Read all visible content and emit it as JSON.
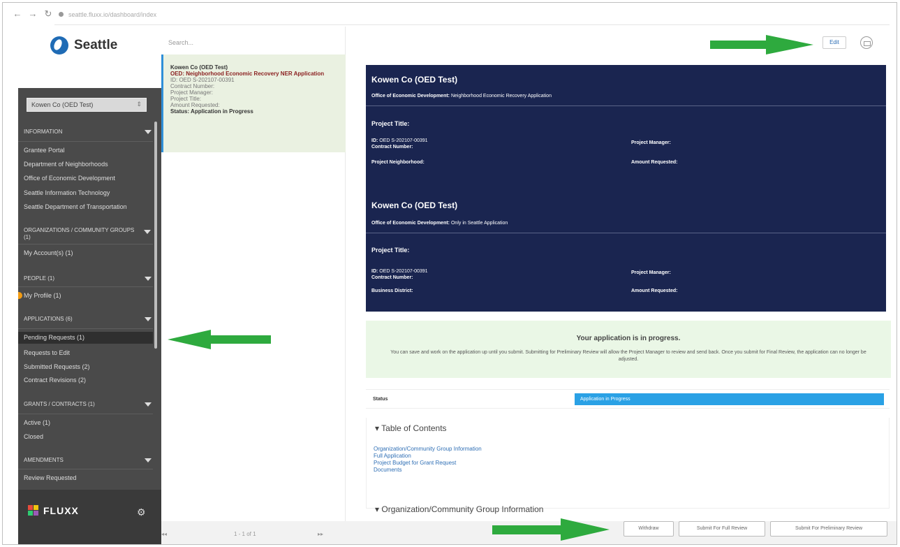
{
  "browser": {
    "url": "seattle.fluxx.io/dashboard/index",
    "back_glyph": "←",
    "forward_glyph": "→",
    "reload_glyph": "↻"
  },
  "brand": {
    "city_name": "Seattle",
    "footer_logo": "FLUXX",
    "accent_color": "#1a2550",
    "highlight_color": "#2aa1e5",
    "arrow_color": "#2eaa3e"
  },
  "sidebar": {
    "org_select_value": "Kowen Co (OED Test)",
    "sections": [
      {
        "label": "INFORMATION",
        "items": [
          "Grantee Portal",
          "Department of Neighborhoods",
          "Office of Economic Development",
          "Seattle Information Technology",
          "Seattle Department of Transportation"
        ]
      },
      {
        "label": "ORGANIZATIONS / COMMUNITY GROUPS (1)",
        "items": [
          "My Account(s) (1)"
        ]
      },
      {
        "label": "PEOPLE (1)",
        "items": [
          "My Profile (1)"
        ]
      },
      {
        "label": "APPLICATIONS (6)",
        "items": [
          "Pending Requests (1)",
          "Requests to Edit",
          "Submitted Requests (2)",
          "Contract Revisions (2)"
        ]
      },
      {
        "label": "GRANTS / CONTRACTS (1)",
        "items": [
          "Active (1)",
          "Closed"
        ]
      },
      {
        "label": "AMENDMENTS",
        "items": [
          "Review Requested"
        ]
      }
    ]
  },
  "list": {
    "search_placeholder": "Search...",
    "card": {
      "title": "Kowen Co (OED Test)",
      "program": "OED: Neighborhood Economic Recovery NER Application",
      "id": "ID: OED S-202107-00391",
      "contract_number": "Contract Number:",
      "project_manager": "Project Manager:",
      "project_title": "Project Title:",
      "amount_requested": "Amount Requested:",
      "status": "Status: Application in Progress"
    },
    "pagination": {
      "prev": "◂◂",
      "range": "1 - 1 of 1",
      "next": "▸▸"
    }
  },
  "detail": {
    "edit_label": "Edit",
    "blocks": [
      {
        "org": "Kowen Co (OED Test)",
        "office_label": "Office of Economic Development:",
        "office_value": "Neighborhood Economic Recovery Application",
        "project_title_label": "Project Title:",
        "id_label": "ID:",
        "id_value": "OED S-202107-00391",
        "contract_label": "Contract Number:",
        "pm_label": "Project Manager:",
        "field3_label": "Project Neighborhood:",
        "amount_label": "Amount Requested:"
      },
      {
        "org": "Kowen Co (OED Test)",
        "office_label": "Office of Economic Development:",
        "office_value": "Only in Seattle Application",
        "project_title_label": "Project Title:",
        "id_label": "ID:",
        "id_value": "OED S-202107-00391",
        "contract_label": "Contract Number:",
        "pm_label": "Project Manager:",
        "field3_label": "Business District:",
        "amount_label": "Amount Requested:"
      }
    ],
    "notice": {
      "title": "Your application is in progress.",
      "body": "You can save and work on the application up until you submit. Submitting for Preliminary Review will allow the Project Manager to review and send back. Once you submit for Final Review, the application can no longer be adjusted."
    },
    "status_label": "Status",
    "status_value": "Application in Progress",
    "toc_heading": "▾ Table of Contents",
    "toc_links": [
      "Organization/Community Group Information",
      "Full Application",
      "Project Budget for Grant Request",
      "Documents"
    ],
    "org_info_heading": "▾ Organization/Community Group Information"
  },
  "actions": {
    "withdraw": "Withdraw",
    "full_review": "Submit For Full Review",
    "preliminary_review": "Submit For Preliminary Review"
  }
}
